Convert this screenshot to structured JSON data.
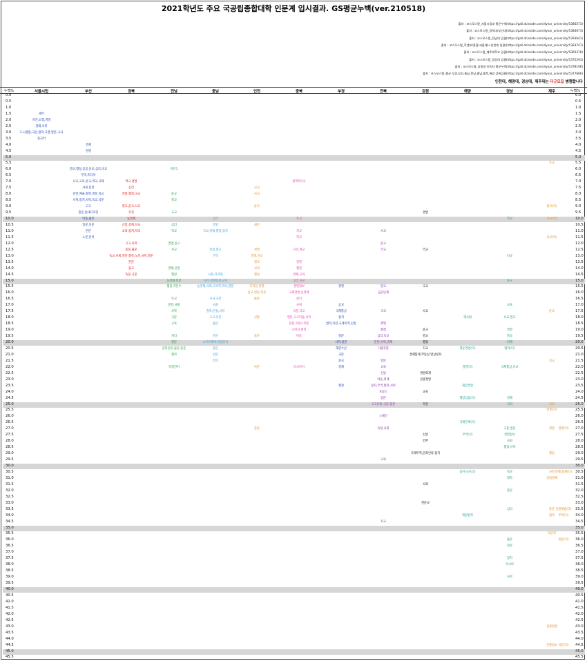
{
  "title": "2021학년도 주요 국공립종합대학 인문계 입시결과. GS평균누백(ver.210518)",
  "sources": [
    "출처 : 코스모스짱_서울시립대 평균누백(https://gall.dcinside.com/4year_university/5386573)",
    "출처 : 코스모스짱_경북대/부산대(https://gall.dcinside.com/4year_university/5384673)",
    "출처 : 코스모스짱_전남대 입결(https://gall.dcinside.com/4year_university/5393641)",
    "출처 : 코스모스짱_학생부/종합/서울대(+인천대 입결)(https://gall.dcinside.com/4year_university/5383747)",
    "출처 : 코스모스짱_제주대학교 입결(https://gall.dcinside.com/4year_university/5360378)",
    "출처 : 코스모스짱_경상대 입결(https://gall.dcinside.com/4year_university/5372293)",
    "출처 : 코스모스짱_강원대 유독자 평균누백(https://gall.dcinside.com/4year_university/5378196)",
    "출처 : 코스모스짱_평균 부경,부산,충남,전남,충남,충북,해양 상위입결(https://gall.dcinside.com/4year_university/5377686)"
  ],
  "note": {
    "before": "인천대, 해양대, 경상대, 제주대는 ",
    "highlight": "다군모집",
    "after": " 병행합니다"
  },
  "header": {
    "left": "누백%",
    "right": "누백%"
  },
  "chart_data": {
    "type": "table",
    "y_label": "누백%",
    "y_range": [
      0.0,
      45.5
    ],
    "y_step": 0.5,
    "bands_every": 5,
    "colors": {
      "서울시립": "#1a3fb0",
      "부산": "#1a3fb0",
      "경북": "#e01010",
      "전남": "#20a040",
      "충남": "#3aa0e0",
      "인천": "#e08a20",
      "충북": "#e040b0",
      "부경": "#1a3fb0",
      "전북": "#8a2ab0",
      "강원": "#111111",
      "해양": "#20a090",
      "경상": "#20a060",
      "제주": "#e08a20"
    },
    "universities": [
      "서울시립",
      "부산",
      "경북",
      "전남",
      "충남",
      "인천",
      "충북",
      "부경",
      "전북",
      "강원",
      "해양",
      "경상",
      "제주"
    ],
    "entries": [
      {
        "u": "서울시립",
        "y": 1.5,
        "t": "세무"
      },
      {
        "u": "서울시립",
        "y": 2.0,
        "t": "자전,도행,경영"
      },
      {
        "u": "서울시립",
        "y": 2.5,
        "t": "경제,사복"
      },
      {
        "u": "서울시립",
        "y": 3.0,
        "t": "도시행정,국문,철학,국영,영문,국사"
      },
      {
        "u": "서울시립",
        "y": 3.5,
        "t": "중국어"
      },
      {
        "u": "부산",
        "y": 4.0,
        "t": "경제"
      },
      {
        "u": "부산",
        "y": 4.5,
        "t": "경영"
      },
      {
        "u": "부산",
        "y": 6.0,
        "t": "영교,행정,공공,윤교,심리,국교"
      },
      {
        "u": "부산",
        "y": 6.5,
        "t": "무역,미디어"
      },
      {
        "u": "부산",
        "y": 7.0,
        "t": "사교,교육,유교,역교,국제"
      },
      {
        "u": "부산",
        "y": 7.5,
        "t": "사회,문헌"
      },
      {
        "u": "부산",
        "y": 8.0,
        "t": "관반,예술,철학,영문,지교"
      },
      {
        "u": "부산",
        "y": 8.5,
        "t": "사학,정치,사복,독교,국문"
      },
      {
        "u": "부산",
        "y": 9.0,
        "t": "고고"
      },
      {
        "u": "부산",
        "y": 9.5,
        "t": "중문,실내디자인"
      },
      {
        "u": "부산",
        "y": 10.0,
        "t": "아동,불문"
      },
      {
        "u": "부산",
        "y": 10.5,
        "t": "일문,독문"
      },
      {
        "u": "부산",
        "y": 11.0,
        "t": "한문"
      },
      {
        "u": "부산",
        "y": 11.5,
        "t": "노문,언어"
      },
      {
        "u": "경북",
        "y": 7.0,
        "t": "역교,경영"
      },
      {
        "u": "경북",
        "y": 7.5,
        "t": "심리"
      },
      {
        "u": "경북",
        "y": 8.0,
        "t": "경통,행정,국교"
      },
      {
        "u": "경북",
        "y": 9.0,
        "t": "영교,윤교,사교"
      },
      {
        "u": "경북",
        "y": 9.5,
        "t": "자전"
      },
      {
        "u": "경북",
        "y": 10.0,
        "t": "농경제"
      },
      {
        "u": "경북",
        "y": 10.5,
        "t": "신방,경제,지교"
      },
      {
        "u": "경북",
        "y": 11.0,
        "t": "교육,정치,지리"
      },
      {
        "u": "경북",
        "y": 12.0,
        "t": "고고,사복"
      },
      {
        "u": "경북",
        "y": 12.5,
        "t": "중문,불문"
      },
      {
        "u": "경북",
        "y": 13.0,
        "t": "독교,사회,영문,철학,노문,사학,영문"
      },
      {
        "u": "경북",
        "y": 13.5,
        "t": "한문"
      },
      {
        "u": "경북",
        "y": 14.0,
        "t": "불교"
      },
      {
        "u": "경북",
        "y": 14.5,
        "t": "독문,국문"
      },
      {
        "u": "전남",
        "y": 6.0,
        "t": "자전1"
      },
      {
        "u": "전남",
        "y": 8.0,
        "t": "윤교"
      },
      {
        "u": "전남",
        "y": 8.5,
        "t": "영교"
      },
      {
        "u": "전남",
        "y": 9.5,
        "t": "국교"
      },
      {
        "u": "전남",
        "y": 10.5,
        "t": "심리"
      },
      {
        "u": "전남",
        "y": 11.0,
        "t": "역교"
      },
      {
        "u": "전남",
        "y": 12.0,
        "t": "경영,윤교"
      },
      {
        "u": "전남",
        "y": 12.5,
        "t": "지교"
      },
      {
        "u": "전남",
        "y": 14.0,
        "t": "경제,신방"
      },
      {
        "u": "전남",
        "y": 14.5,
        "t": "행정"
      },
      {
        "u": "전남",
        "y": 15.0,
        "t": "농경제,영문"
      },
      {
        "u": "전남",
        "y": 15.5,
        "t": "행정,지전수"
      },
      {
        "u": "전남",
        "y": 16.5,
        "t": "독교"
      },
      {
        "u": "전남",
        "y": 17.0,
        "t": "문헌,사회"
      },
      {
        "u": "전남",
        "y": 17.5,
        "t": "사학"
      },
      {
        "u": "전남",
        "y": 18.0,
        "t": "국문"
      },
      {
        "u": "전남",
        "y": 18.5,
        "t": "교육"
      },
      {
        "u": "전남",
        "y": 19.5,
        "t": "지리"
      },
      {
        "u": "전남",
        "y": 20.0,
        "t": "철문"
      },
      {
        "u": "전남",
        "y": 20.5,
        "t": "문화인류,불문,중문"
      },
      {
        "u": "전남",
        "y": 21.0,
        "t": "철학"
      },
      {
        "u": "전남",
        "y": 22.0,
        "t": "독일언어"
      },
      {
        "u": "충남",
        "y": 10.0,
        "t": "심리"
      },
      {
        "u": "충남",
        "y": 10.5,
        "t": "경영"
      },
      {
        "u": "충남",
        "y": 11.0,
        "t": "국교,경제,행정,정치"
      },
      {
        "u": "충남",
        "y": 12.5,
        "t": "언정,영교"
      },
      {
        "u": "충남",
        "y": 13.0,
        "t": "무역"
      },
      {
        "u": "충남",
        "y": 14.5,
        "t": "사회,자치행"
      },
      {
        "u": "충남",
        "y": 15.0,
        "t": "자전,경제통계,교육"
      },
      {
        "u": "충남",
        "y": 15.5,
        "t": "농경제,사회,국사학,역사,영문"
      },
      {
        "u": "충남",
        "y": 16.5,
        "t": "국사,국문"
      },
      {
        "u": "충남",
        "y": 17.0,
        "t": "사회"
      },
      {
        "u": "충남",
        "y": 17.5,
        "t": "철학,문정,사학"
      },
      {
        "u": "충남",
        "y": 18.0,
        "t": "고고,독문"
      },
      {
        "u": "충남",
        "y": 18.5,
        "t": "불문"
      },
      {
        "u": "충남",
        "y": 19.5,
        "t": "한문"
      },
      {
        "u": "충남",
        "y": 20.0,
        "t": "소프트웨어,독일언어"
      },
      {
        "u": "충남",
        "y": 20.5,
        "t": "중문"
      },
      {
        "u": "충남",
        "y": 21.0,
        "t": "일문"
      },
      {
        "u": "충남",
        "y": 21.5,
        "t": "언어"
      },
      {
        "u": "인천",
        "y": 7.5,
        "t": "국교"
      },
      {
        "u": "인천",
        "y": 8.0,
        "t": "국교"
      },
      {
        "u": "인천",
        "y": 9.0,
        "t": "윤교"
      },
      {
        "u": "인천",
        "y": 10.5,
        "t": "세무"
      },
      {
        "u": "인천",
        "y": 12.5,
        "t": "경영"
      },
      {
        "u": "인천",
        "y": 13.0,
        "t": "경영,유교"
      },
      {
        "u": "인천",
        "y": 13.5,
        "t": "영교"
      },
      {
        "u": "인천",
        "y": 14.0,
        "t": "사회"
      },
      {
        "u": "인천",
        "y": 14.5,
        "t": "행정"
      },
      {
        "u": "인천",
        "y": 15.5,
        "t": "디자인,경영"
      },
      {
        "u": "인천",
        "y": 16.0,
        "t": "동교,일문,독문"
      },
      {
        "u": "인천",
        "y": 16.5,
        "t": "불문"
      },
      {
        "u": "인천",
        "y": 18.0,
        "t": "신방"
      },
      {
        "u": "인천",
        "y": 19.5,
        "t": "중문"
      },
      {
        "u": "인천",
        "y": 22.0,
        "t": "아문"
      },
      {
        "u": "인천",
        "y": 27.0,
        "t": "중문"
      },
      {
        "u": "충북",
        "y": 7.0,
        "t": "정책학(다)"
      },
      {
        "u": "충북",
        "y": 10.0,
        "t": "유교"
      },
      {
        "u": "충북",
        "y": 11.0,
        "t": "지교"
      },
      {
        "u": "충북",
        "y": 11.5,
        "t": "역교"
      },
      {
        "u": "충북",
        "y": 12.5,
        "t": "자전,영교"
      },
      {
        "u": "충북",
        "y": 13.5,
        "t": "경영"
      },
      {
        "u": "충북",
        "y": 14.0,
        "t": "행정"
      },
      {
        "u": "충북",
        "y": 14.5,
        "t": "경제,교육"
      },
      {
        "u": "충북",
        "y": 15.0,
        "t": "심리,사교"
      },
      {
        "u": "충북",
        "y": 15.5,
        "t": "경영정보"
      },
      {
        "u": "충북",
        "y": 16.0,
        "t": "국제경영,농경제"
      },
      {
        "u": "충북",
        "y": 16.5,
        "t": "정치"
      },
      {
        "u": "충북",
        "y": 17.0,
        "t": "사회"
      },
      {
        "u": "충북",
        "y": 17.5,
        "t": "국문,국교"
      },
      {
        "u": "충북",
        "y": 18.0,
        "t": "영문,고고미술,사학"
      },
      {
        "u": "충북",
        "y": 18.5,
        "t": "중문,프랑스어문"
      },
      {
        "u": "충북",
        "y": 19.0,
        "t": "소비자,철학"
      },
      {
        "u": "충북",
        "y": 19.5,
        "t": "아동"
      },
      {
        "u": "충북",
        "y": 22.0,
        "t": "러시아어"
      },
      {
        "u": "부경",
        "y": 15.5,
        "t": "경영"
      },
      {
        "u": "부경",
        "y": 17.0,
        "t": "공교"
      },
      {
        "u": "부경",
        "y": 17.5,
        "t": "국제통상"
      },
      {
        "u": "부경",
        "y": 18.0,
        "t": "정치"
      },
      {
        "u": "부경",
        "y": 18.5,
        "t": "법학,자전,국제지역,신방"
      },
      {
        "u": "부경",
        "y": 19.5,
        "t": "영문"
      },
      {
        "u": "부경",
        "y": 20.0,
        "t": "사학,일문"
      },
      {
        "u": "부경",
        "y": 20.5,
        "t": "해양수산"
      },
      {
        "u": "부경",
        "y": 21.0,
        "t": "국문"
      },
      {
        "u": "부경",
        "y": 21.5,
        "t": "중국"
      },
      {
        "u": "부경",
        "y": 22.0,
        "t": "경제"
      },
      {
        "u": "부경",
        "y": 23.5,
        "t": "행정"
      },
      {
        "u": "전북",
        "y": 11.0,
        "t": "사교"
      },
      {
        "u": "전북",
        "y": 12.0,
        "t": "윤교"
      },
      {
        "u": "전북",
        "y": 12.5,
        "t": "역교"
      },
      {
        "u": "전북",
        "y": 15.5,
        "t": "영교"
      },
      {
        "u": "전북",
        "y": 16.0,
        "t": "공공인재"
      },
      {
        "u": "전북",
        "y": 17.5,
        "t": "국교"
      },
      {
        "u": "전북",
        "y": 18.5,
        "t": "경영"
      },
      {
        "u": "전북",
        "y": 19.0,
        "t": "행정"
      },
      {
        "u": "전북",
        "y": 19.5,
        "t": "심리,독교"
      },
      {
        "u": "전북",
        "y": 20.0,
        "t": "문헌,사복,경제"
      },
      {
        "u": "전북",
        "y": 20.5,
        "t": "식품유통"
      },
      {
        "u": "전북",
        "y": 21.5,
        "t": "영문"
      },
      {
        "u": "전북",
        "y": 22.0,
        "t": "교육"
      },
      {
        "u": "전북",
        "y": 22.5,
        "t": "신방"
      },
      {
        "u": "전북",
        "y": 23.0,
        "t": "아동,회계"
      },
      {
        "u": "전북",
        "y": 23.5,
        "t": "정치,무역,철학,사학"
      },
      {
        "u": "전북",
        "y": 24.0,
        "t": "프랑스"
      },
      {
        "u": "전북",
        "y": 24.5,
        "t": "일문"
      },
      {
        "u": "전북",
        "y": 25.0,
        "t": "고고인류,국문,중문"
      },
      {
        "u": "전북",
        "y": 26.0,
        "t": "스페인"
      },
      {
        "u": "전북",
        "y": 27.0,
        "t": "독일,사회"
      },
      {
        "u": "전북",
        "y": 29.5,
        "t": "교육"
      },
      {
        "u": "전북",
        "y": 34.5,
        "t": "지교"
      },
      {
        "u": "강원",
        "y": 9.5,
        "t": "경영"
      },
      {
        "u": "강원",
        "y": 12.5,
        "t": "역교"
      },
      {
        "u": "강원",
        "y": 15.5,
        "t": "국교"
      },
      {
        "u": "강원",
        "y": 17.5,
        "t": "사교"
      },
      {
        "u": "강원",
        "y": 19.0,
        "t": "윤교"
      },
      {
        "u": "강원",
        "y": 19.5,
        "t": "영교"
      },
      {
        "u": "강원",
        "y": 20.0,
        "t": "행정"
      },
      {
        "u": "강원",
        "y": 20.5,
        "t": "지교"
      },
      {
        "u": "강원",
        "y": 21.0,
        "t": "경제통계,부동산,영상문화"
      },
      {
        "u": "강원",
        "y": 22.5,
        "t": "경영회계"
      },
      {
        "u": "강원",
        "y": 23.0,
        "t": "관광경영"
      },
      {
        "u": "강원",
        "y": 24.0,
        "t": "교육"
      },
      {
        "u": "강원",
        "y": 25.0,
        "t": "자전"
      },
      {
        "u": "강원",
        "y": 27.5,
        "t": "신방"
      },
      {
        "u": "강원",
        "y": 28.0,
        "t": "언론"
      },
      {
        "u": "강원",
        "y": 29.0,
        "t": "국제무역,문화인류,정치"
      },
      {
        "u": "강원",
        "y": 31.5,
        "t": "사회"
      },
      {
        "u": "강원",
        "y": 33.0,
        "t": "한문교"
      },
      {
        "u": "해양",
        "y": 18.0,
        "t": "해사법"
      },
      {
        "u": "해양",
        "y": 20.5,
        "t": "해운경영(다)"
      },
      {
        "u": "해양",
        "y": 22.0,
        "t": "경영(다)"
      },
      {
        "u": "해양",
        "y": 23.5,
        "t": "해양경영"
      },
      {
        "u": "해양",
        "y": 24.5,
        "t": "해양금융(다)"
      },
      {
        "u": "해양",
        "y": 26.5,
        "t": "국제관계(다)"
      },
      {
        "u": "해양",
        "y": 27.5,
        "t": "무역(다)"
      },
      {
        "u": "해양",
        "y": 30.5,
        "t": "동아시아(다)"
      },
      {
        "u": "해양",
        "y": 34.0,
        "t": "해양법학"
      },
      {
        "u": "경상",
        "y": 10.0,
        "t": "역교"
      },
      {
        "u": "경상",
        "y": 13.0,
        "t": "지교"
      },
      {
        "u": "경상",
        "y": 15.0,
        "t": "윤교"
      },
      {
        "u": "경상",
        "y": 17.0,
        "t": "교육"
      },
      {
        "u": "경상",
        "y": 18.0,
        "t": "사교,영교"
      },
      {
        "u": "경상",
        "y": 19.0,
        "t": "경영"
      },
      {
        "u": "경상",
        "y": 19.5,
        "t": "영교"
      },
      {
        "u": "경상",
        "y": 20.0,
        "t": "회계"
      },
      {
        "u": "경상",
        "y": 20.5,
        "t": "법학(다)"
      },
      {
        "u": "경상",
        "y": 22.0,
        "t": "국제통상,유교"
      },
      {
        "u": "경상",
        "y": 24.5,
        "t": "경제"
      },
      {
        "u": "경상",
        "y": 25.0,
        "t": "사회"
      },
      {
        "u": "경상",
        "y": 27.0,
        "t": "국문,영문"
      },
      {
        "u": "경상",
        "y": 27.5,
        "t": "경영정보"
      },
      {
        "u": "경상",
        "y": 28.0,
        "t": "사회"
      },
      {
        "u": "경상",
        "y": 28.5,
        "t": "행정,사복"
      },
      {
        "u": "경상",
        "y": 30.5,
        "t": "독문"
      },
      {
        "u": "경상",
        "y": 31.0,
        "t": "철학"
      },
      {
        "u": "경상",
        "y": 32.0,
        "t": "중문"
      },
      {
        "u": "경상",
        "y": 33.5,
        "t": "심리"
      },
      {
        "u": "경상",
        "y": 36.0,
        "t": "불문"
      },
      {
        "u": "경상",
        "y": 36.5,
        "t": "한문"
      },
      {
        "u": "경상",
        "y": 37.5,
        "t": "정치"
      },
      {
        "u": "경상",
        "y": 38.0,
        "t": "러시아"
      },
      {
        "u": "경상",
        "y": 39.0,
        "t": "사학"
      },
      {
        "u": "제주",
        "y": 5.5,
        "t": "초교"
      },
      {
        "u": "제주",
        "y": 9.0,
        "t": "영교(다)"
      },
      {
        "u": "제주",
        "y": 10.0,
        "t": "국교(다)"
      },
      {
        "u": "제주",
        "y": 11.5,
        "t": "사교(다)"
      },
      {
        "u": "제주",
        "y": 17.5,
        "t": "윤교"
      },
      {
        "u": "제주",
        "y": 21.5,
        "t": "지교"
      },
      {
        "u": "제주",
        "y": 25.0,
        "t": "사회"
      },
      {
        "u": "제주",
        "y": 25.5,
        "t": "언론(다)"
      },
      {
        "u": "제주",
        "y": 27.0,
        "t": "경영"
      },
      {
        "u": "제주",
        "y": 27.0,
        "t": "경영(다)",
        "right": true
      },
      {
        "u": "제주",
        "y": 29.0,
        "t": "행정"
      },
      {
        "u": "제주",
        "y": 30.5,
        "t": "사학"
      },
      {
        "u": "제주",
        "y": 30.5,
        "t": "경제,회계(다)",
        "right": true
      },
      {
        "u": "제주",
        "y": 31.0,
        "t": "산업경제"
      },
      {
        "u": "제주",
        "y": 33.5,
        "t": "중문"
      },
      {
        "u": "제주",
        "y": 33.5,
        "t": "관광개발(다)",
        "right": true
      },
      {
        "u": "제주",
        "y": 34.0,
        "t": "철학"
      },
      {
        "u": "제주",
        "y": 34.0,
        "t": "무역(다)",
        "right": true
      },
      {
        "u": "제주",
        "y": 35.5,
        "t": "독문학"
      },
      {
        "u": "제주",
        "y": 36.0,
        "t": "일문(다)",
        "right": true
      },
      {
        "u": "제주",
        "y": 43.0,
        "t": "관광경영"
      },
      {
        "u": "제주",
        "y": 44.5,
        "t": "관광정보"
      },
      {
        "u": "제주",
        "y": 44.5,
        "t": "국문(다)",
        "right": true
      }
    ]
  }
}
